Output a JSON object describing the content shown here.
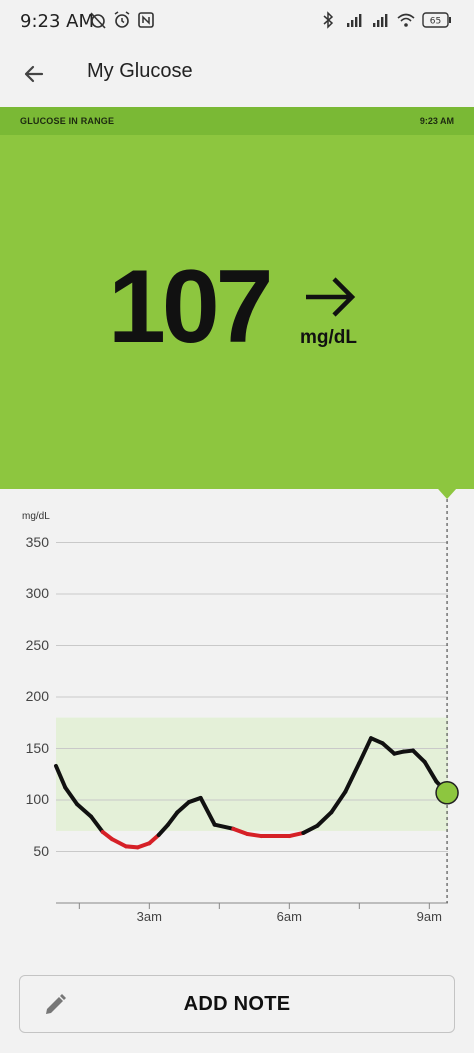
{
  "status_bar": {
    "time": "9:23 AM",
    "battery": "65",
    "icons": [
      "alarm-off-icon",
      "alarm-icon",
      "nfc-icon",
      "bluetooth-icon",
      "signal-icon",
      "signal-icon",
      "wifi-icon",
      "battery-icon"
    ]
  },
  "app_bar": {
    "title": "My Glucose",
    "back_icon": "arrow-back-icon"
  },
  "banner": {
    "label": "GLUCOSE IN RANGE",
    "time": "9:23 AM",
    "color": "#7ab935"
  },
  "reading": {
    "value": "107",
    "unit": "mg/dL",
    "trend_icon": "arrow-right-icon",
    "color": "#8dc63f"
  },
  "chart_data": {
    "type": "line",
    "ylabel": "mg/dL",
    "y_ticks": [
      "350",
      "300",
      "250",
      "200",
      "150",
      "100",
      "50"
    ],
    "x_ticks": [
      "3am",
      "6am",
      "9am"
    ],
    "ylim": [
      0,
      350
    ],
    "target_range": [
      70,
      180
    ],
    "low_threshold": 70,
    "x_range_hours": [
      1.0,
      9.4
    ],
    "x_tick_hours": [
      3,
      6,
      9
    ],
    "x": [
      1.0,
      1.2,
      1.45,
      1.75,
      2.0,
      2.2,
      2.5,
      2.75,
      3.0,
      3.2,
      3.4,
      3.6,
      3.85,
      4.1,
      4.4,
      4.8,
      5.1,
      5.4,
      5.7,
      6.0,
      6.3,
      6.6,
      6.9,
      7.2,
      7.5,
      7.75,
      8.0,
      8.25,
      8.45,
      8.65,
      8.9,
      9.15,
      9.38
    ],
    "values": [
      133,
      112,
      96,
      84,
      69,
      62,
      55,
      54,
      58,
      66,
      76,
      88,
      98,
      102,
      76,
      72,
      67,
      65,
      65,
      65,
      68,
      75,
      88,
      108,
      136,
      160,
      155,
      145,
      147,
      148,
      137,
      118,
      107
    ],
    "colors": {
      "line": "#111111",
      "low": "#d62027",
      "range_fill": "#e4f0d8",
      "current_point": "#8dc63f"
    }
  },
  "add_note": {
    "label": "ADD NOTE",
    "icon": "pencil-icon"
  }
}
